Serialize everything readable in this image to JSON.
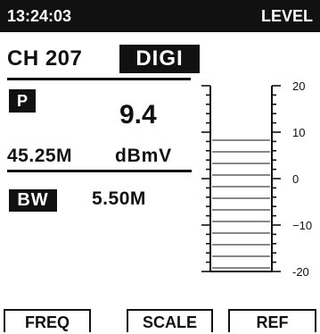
{
  "header": {
    "time": "13:24:03",
    "mode": "LEVEL"
  },
  "channel": {
    "label": "CH 207",
    "mode": "DIGI"
  },
  "power": {
    "badge": "P",
    "value": "9.4"
  },
  "frequency": {
    "value": "45.25M",
    "unit": "dBmV"
  },
  "bandwidth": {
    "badge": "BW",
    "value": "5.50M"
  },
  "meter": {
    "scale_labels": [
      "20",
      "10",
      "0",
      "−10",
      "-20"
    ],
    "scale_min": -20,
    "scale_max": 20,
    "level_dbmv": 9.4
  },
  "softkeys": {
    "key1": "FREQ",
    "key2": "SCALE",
    "key3": "REF"
  }
}
